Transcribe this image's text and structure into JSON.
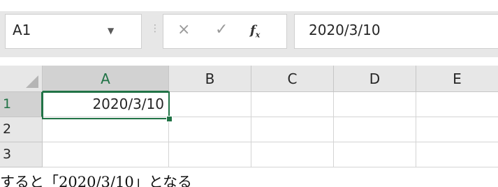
{
  "formula_bar": {
    "name_box": "A1",
    "formula_value": "2020/3/10",
    "cancel_glyph": "×",
    "enter_glyph": "✓",
    "fx_label": "f",
    "fx_sub": "x"
  },
  "columns": [
    "A",
    "B",
    "C",
    "D",
    "E"
  ],
  "rows": [
    "1",
    "2",
    "3"
  ],
  "cells": {
    "A1": "2020/3/10"
  },
  "caption": "すると「2020/3/10」となる",
  "colors": {
    "accent": "#217346",
    "header_bg": "#e7e7e7",
    "selected_header_bg": "#d2d2d2"
  }
}
